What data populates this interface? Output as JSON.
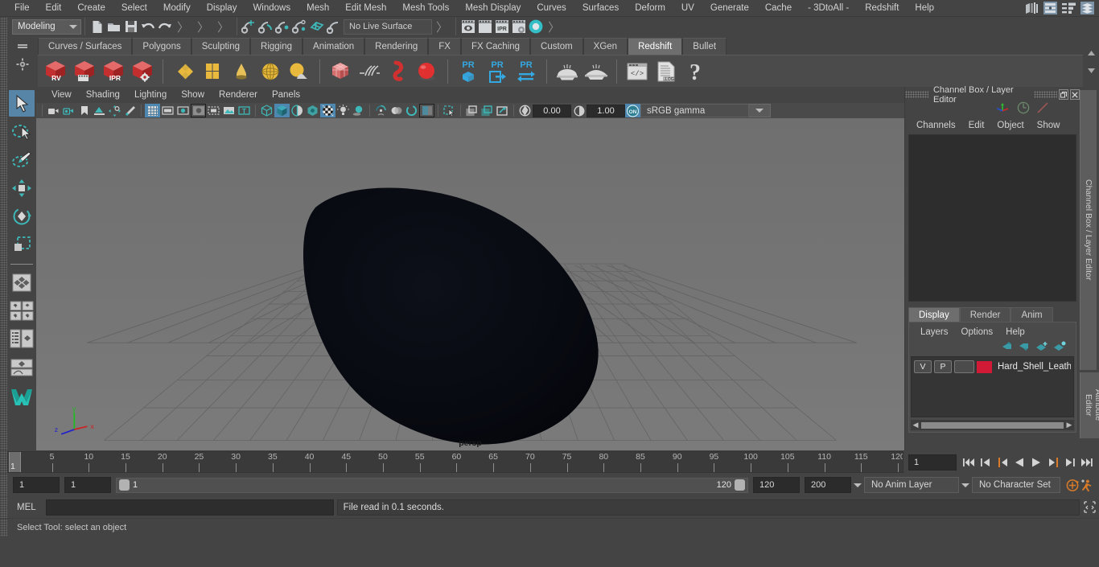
{
  "menubar": {
    "items": [
      "File",
      "Edit",
      "Create",
      "Select",
      "Modify",
      "Display",
      "Windows",
      "Mesh",
      "Edit Mesh",
      "Mesh Tools",
      "Mesh Display",
      "Curves",
      "Surfaces",
      "Deform",
      "UV",
      "Generate",
      "Cache",
      "- 3DtoAll -",
      "Redshift",
      "Help"
    ],
    "right_icons": [
      "sidebar-toggle-icon",
      "channelbox-toggle-icon",
      "attribute-editor-toggle-icon",
      "tool-settings-toggle-icon"
    ]
  },
  "statusline": {
    "mode": "Modeling",
    "live_surface": "No Live Surface",
    "icons": [
      "new-scene-icon",
      "open-scene-icon",
      "save-scene-icon",
      "undo-icon",
      "redo-icon",
      "snap-to-grid-icon",
      "snap-to-curve-icon",
      "snap-to-point-icon",
      "snap-to-projected-center-icon",
      "snap-to-view-plane-icon",
      "make-live-icon",
      "render-current-frame-icon",
      "ipr-render-icon",
      "render-sequence-icon",
      "render-settings-icon",
      "hypershade-icon"
    ]
  },
  "shelf": {
    "tabs": [
      {
        "label": "Curves / Surfaces",
        "active": false
      },
      {
        "label": "Polygons",
        "active": false
      },
      {
        "label": "Sculpting",
        "active": false
      },
      {
        "label": "Rigging",
        "active": false
      },
      {
        "label": "Animation",
        "active": false
      },
      {
        "label": "Rendering",
        "active": false
      },
      {
        "label": "FX",
        "active": false
      },
      {
        "label": "FX Caching",
        "active": false
      },
      {
        "label": "Custom",
        "active": false
      },
      {
        "label": "XGen",
        "active": false
      },
      {
        "label": "Redshift",
        "active": true
      },
      {
        "label": "Bullet",
        "active": false
      }
    ],
    "icon_labels": [
      "RV",
      "IPR",
      "PR",
      "PR",
      "PR",
      ".LOG"
    ],
    "icons": [
      "redshift-rv-icon",
      "redshift-render-sequence-icon",
      "redshift-ipr-icon",
      "redshift-render-settings-icon",
      "redshift-proxy-mesh-icon",
      "redshift-matte-icon",
      "redshift-bokeh-icon",
      "redshift-dome-light-icon",
      "redshift-environment-icon",
      "redshift-volume-icon",
      "redshift-hair-icon",
      "redshift-sprite-icon",
      "redshift-material-icon",
      "redshift-proxy-create-icon",
      "redshift-proxy-export-icon",
      "redshift-proxy-convert-icon",
      "redshift-dome-icon",
      "redshift-ies-icon",
      "redshift-script-editor-icon",
      "redshift-log-icon",
      "redshift-help-icon"
    ]
  },
  "toolbox": {
    "items": [
      {
        "name": "select-tool",
        "selected": true
      },
      {
        "name": "lasso-select-tool",
        "selected": false
      },
      {
        "name": "paint-select-tool",
        "selected": false
      },
      {
        "name": "move-tool",
        "selected": false
      },
      {
        "name": "rotate-tool",
        "selected": false
      },
      {
        "name": "scale-tool",
        "selected": false
      },
      {
        "name": "four-view-layout",
        "selected": false
      },
      {
        "name": "two-pane-layout",
        "selected": false
      },
      {
        "name": "outliner-persp-layout",
        "selected": false
      },
      {
        "name": "persp-graph-layout",
        "selected": false
      }
    ]
  },
  "viewport": {
    "menus": [
      "View",
      "Shading",
      "Lighting",
      "Show",
      "Renderer",
      "Panels"
    ],
    "camera_label": "persp",
    "exposure": "0.00",
    "gamma": "1.00",
    "view_transform": "sRGB gamma",
    "color_mgmt_toggle": "ON",
    "toolbar_icons": [
      "select-camera-icon",
      "camera-attributes-icon",
      "bookmark-icon",
      "image-plane-icon",
      "two-d-pan-zoom-icon",
      "grease-pencil-icon",
      "grid-toggle-icon",
      "film-gate-icon",
      "resolution-gate-icon",
      "gate-mask-icon",
      "field-chart-icon",
      "safe-action-icon",
      "safe-title-icon",
      "wireframe-icon",
      "smooth-shade-all-icon",
      "shade-all-but-active-wireframe-icon",
      "use-default-material-icon",
      "shaded-textured-icon",
      "use-all-lights-icon",
      "shadows-icon",
      "screen-space-ao-icon",
      "motion-blur-icon",
      "multisample-aa-icon",
      "depth-of-field-icon",
      "isolate-select-icon",
      "xray-icon",
      "xray-joints-icon",
      "xray-active-components-icon",
      "view-camera-icon"
    ],
    "axis_labels": [
      "x",
      "y",
      "z"
    ]
  },
  "channel_box": {
    "title": "Channel Box / Layer Editor",
    "menus": [
      "Channels",
      "Edit",
      "Object",
      "Show"
    ],
    "gizmo_icons": [
      "axis-gizmo-icon",
      "clock-gizmo-icon",
      "slash-gizmo-icon"
    ],
    "window_buttons": [
      "restore-window-icon",
      "close-window-icon"
    ]
  },
  "layer_editor": {
    "tabs": [
      {
        "label": "Display",
        "active": true
      },
      {
        "label": "Render",
        "active": false
      },
      {
        "label": "Anim",
        "active": false
      }
    ],
    "menus": [
      "Layers",
      "Options",
      "Help"
    ],
    "icon_buttons": [
      "move-layer-up-icon",
      "move-layer-down-icon",
      "create-new-layer-icon",
      "create-layer-from-selected-icon"
    ],
    "layers": [
      {
        "visibility": "V",
        "playback": "P",
        "state": "",
        "color": "#d11a35",
        "name": "Hard_Shell_Leather_Ey"
      }
    ]
  },
  "vertical_tabs": [
    {
      "label": "Channel Box / Layer Editor",
      "size": "tall"
    },
    {
      "label": "Attribute Editor",
      "size": "short"
    }
  ],
  "timeline": {
    "start": 1,
    "end": 120,
    "current_frame": "1",
    "tick_labels": [
      5,
      10,
      15,
      20,
      25,
      30,
      35,
      40,
      45,
      50,
      55,
      60,
      65,
      70,
      75,
      80,
      85,
      90,
      95,
      100,
      105,
      110,
      115,
      120
    ],
    "current_label": "1",
    "playback_buttons": [
      "go-to-start-icon",
      "step-back-keyframe-icon",
      "step-back-frame-icon",
      "play-backwards-icon",
      "play-forwards-icon",
      "step-forward-frame-icon",
      "step-forward-keyframe-icon",
      "go-to-end-icon"
    ]
  },
  "range": {
    "anim_start": "1",
    "range_start": "1",
    "slider_start": "1",
    "slider_end": "120",
    "range_end": "120",
    "anim_end": "200",
    "anim_layer": "No Anim Layer",
    "character_set": "No Character Set",
    "right_icons": [
      "auto-keyframe-icon",
      "animation-preferences-icon"
    ]
  },
  "command_line": {
    "language": "MEL",
    "input_value": "",
    "result": "File read in  0.1 seconds.",
    "end_icon": "script-editor-icon"
  },
  "help_line": {
    "text": "Select Tool: select an object"
  },
  "colors": {
    "accent_teal": "#3eb8b8",
    "accent_blue": "#4e88b0",
    "redshift_red": "#d0393a",
    "shelf_yellow": "#e8b93c",
    "layer_red": "#d11a35",
    "axis_x": "#cc2222",
    "axis_y": "#22bb22",
    "axis_z": "#2222cc",
    "bg_panel": "#444444",
    "bg_viewport": "#727272",
    "orange": "#d97b28"
  }
}
